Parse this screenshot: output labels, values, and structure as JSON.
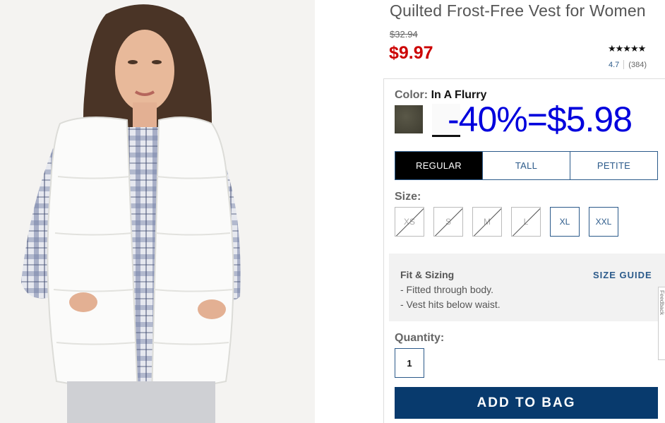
{
  "product": {
    "title": "Quilted Frost-Free Vest for Women",
    "original_price": "$32.94",
    "sale_price": "$9.97",
    "rating_stars": "★★★★★",
    "rating_value": "4.7",
    "review_count": "(384)"
  },
  "color": {
    "label": "Color:",
    "selected": "In A Flurry",
    "swatches": [
      {
        "name": "olive",
        "hex": "#4c4a3c"
      },
      {
        "name": "in-a-flurry",
        "hex": "#fafafa"
      }
    ]
  },
  "discount_note": "-40%=$5.98",
  "fit_tabs": [
    {
      "label": "REGULAR",
      "active": true
    },
    {
      "label": "TALL",
      "active": false
    },
    {
      "label": "PETITE",
      "active": false
    }
  ],
  "size": {
    "label": "Size:",
    "options": [
      {
        "label": "XS",
        "available": false
      },
      {
        "label": "S",
        "available": false
      },
      {
        "label": "M",
        "available": false
      },
      {
        "label": "L",
        "available": false
      },
      {
        "label": "XL",
        "available": true
      },
      {
        "label": "XXL",
        "available": true
      }
    ]
  },
  "fit_sizing": {
    "title": "Fit & Sizing",
    "size_guide": "SIZE GUIDE",
    "items": [
      "- Fitted through body.",
      "- Vest hits below waist."
    ]
  },
  "feedback_label": "Feedback",
  "quantity": {
    "label": "Quantity:",
    "value": "1"
  },
  "add_to_bag": "ADD TO BAG",
  "colors": {
    "accent": "#2b5a8a",
    "sale": "#cc0000",
    "button": "#083a6d",
    "note": "#0000dd"
  }
}
